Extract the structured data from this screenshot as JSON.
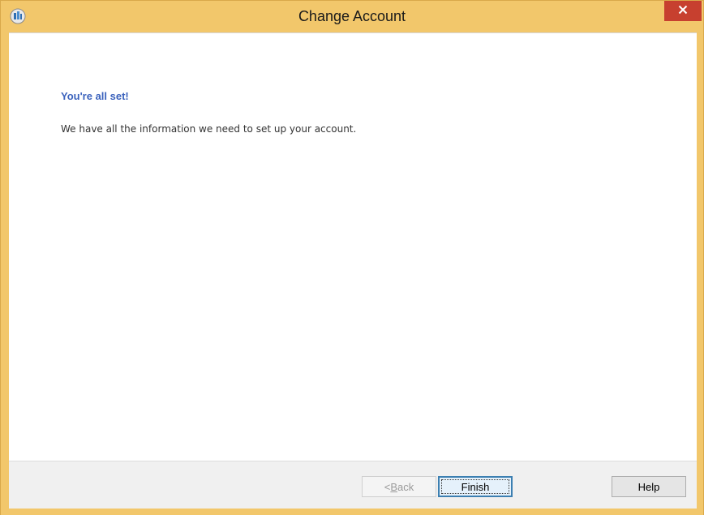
{
  "window": {
    "title": "Change Account",
    "app_icon": "outlook-app-icon",
    "close_icon": "close-icon",
    "accent_color": "#f2c76b",
    "close_color": "#c7402f"
  },
  "content": {
    "heading": "You're all set!",
    "message": "We have all the information we need to set up your account.",
    "heading_color": "#3c63bd"
  },
  "buttons": {
    "back_prefix": "< ",
    "back_access_key": "B",
    "back_rest": "ack",
    "finish_label": "Finish",
    "help_label": "Help"
  }
}
